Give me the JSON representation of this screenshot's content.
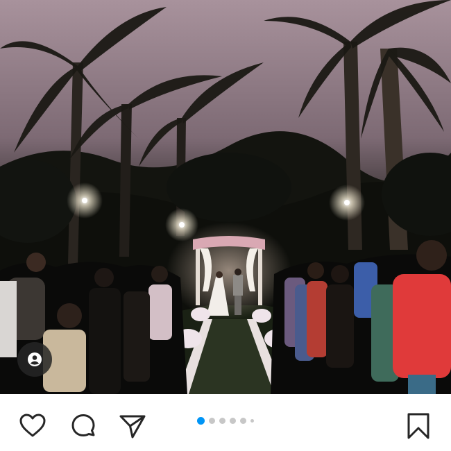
{
  "post": {
    "image_alt": "",
    "accent_color": "#0095f6",
    "carousel": {
      "current_index": 1,
      "dots_visible": 6
    }
  },
  "icons": {
    "user_tag": "user-tag-icon",
    "like": "heart-icon",
    "comment": "comment-bubble-icon",
    "share": "paper-plane-icon",
    "save": "bookmark-icon"
  },
  "colors": {
    "action_icon": "#262626",
    "dot_inactive": "#c7c7c7",
    "dot_active": "#0095f6"
  }
}
